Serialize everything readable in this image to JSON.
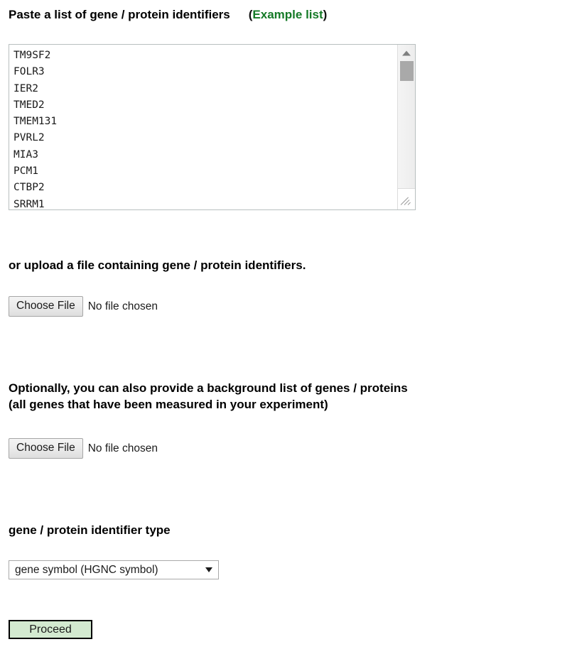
{
  "page": {
    "accent_green": "#157a27",
    "button_green_bg": "#d3ead0"
  },
  "paste_section": {
    "heading": "Paste a list of gene / protein identifiers",
    "paren_open": "(",
    "example_link": "Example list",
    "paren_close": ")",
    "textarea_value": "TM9SF2\nFOLR3\nIER2\nTMED2\nTMEM131\nPVRL2\nMIA3\nPCM1\nCTBP2\nSRRM1",
    "textarea_genes": [
      "TM9SF2",
      "FOLR3",
      "IER2",
      "TMED2",
      "TMEM131",
      "PVRL2",
      "MIA3",
      "PCM1",
      "CTBP2",
      "SRRM1"
    ]
  },
  "upload_section": {
    "heading": "or upload a file containing gene / protein identifiers.",
    "choose_file_label": "Choose File",
    "no_file_label": "No file chosen"
  },
  "background_section": {
    "heading_line1": "Optionally, you can also provide a background list of genes / proteins",
    "heading_line2": "(all genes that have been measured in your experiment)",
    "choose_file_label": "Choose File",
    "no_file_label": "No file chosen"
  },
  "identifier_type_section": {
    "heading": "gene / protein identifier type",
    "selected_option": "gene symbol (HGNC symbol)"
  },
  "submit": {
    "proceed_label": "Proceed"
  }
}
